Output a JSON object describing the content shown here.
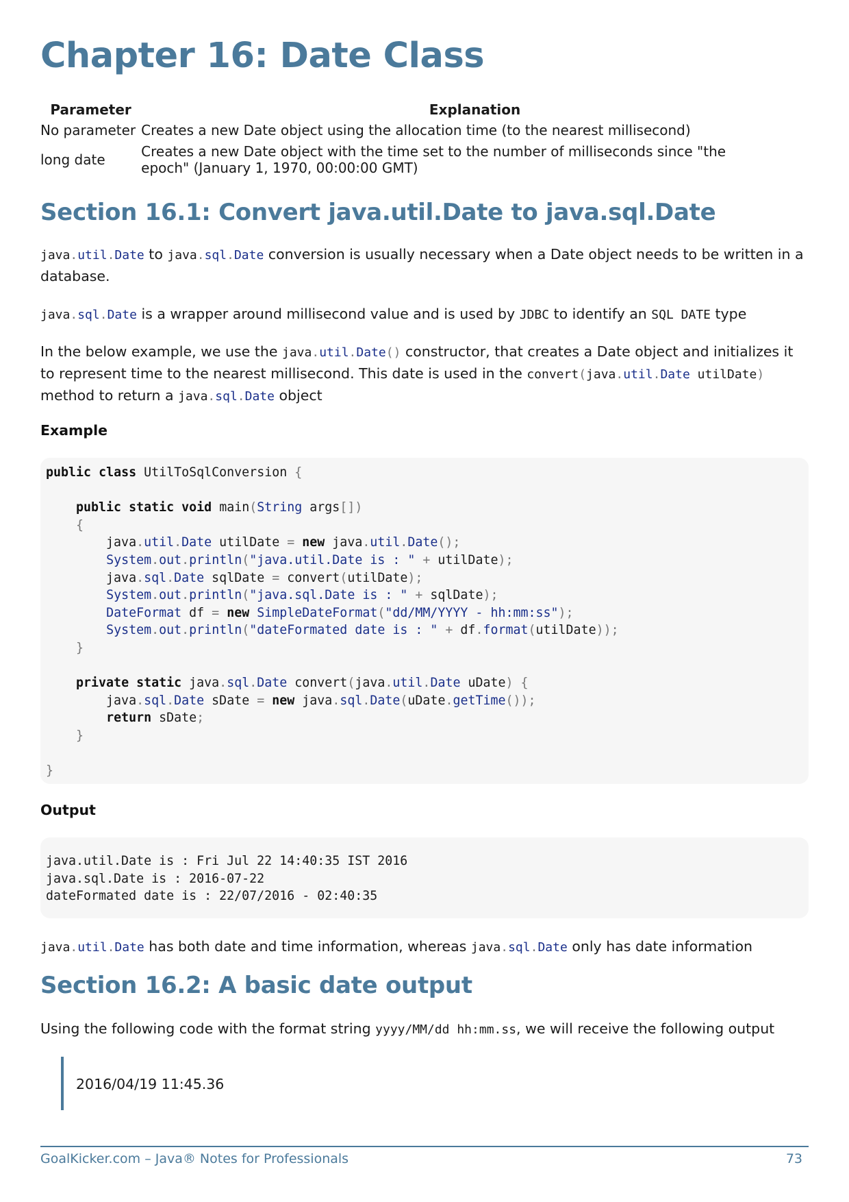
{
  "chapter_title": "Chapter 16: Date Class",
  "param_table": {
    "headers": [
      "Parameter",
      "Explanation"
    ],
    "rows": [
      [
        "No parameter",
        "Creates a new Date object using the allocation time (to the nearest millisecond)"
      ],
      [
        "long date",
        "Creates a new Date object with the time set to the number of milliseconds since \"the epoch\" (January 1, 1970, 00:00:00 GMT)"
      ]
    ]
  },
  "section1": {
    "title": "Section 16.1: Convert java.util.Date to java.sql.Date",
    "p1_a": "java.util.Date",
    "p1_b": " to ",
    "p1_c": "java.sql.Date",
    "p1_d": " conversion is usually necessary when a Date object needs to be written in a database.",
    "p2_a": "java.sql.Date",
    "p2_b": " is a wrapper around millisecond value and is used by ",
    "p2_c": "JDBC",
    "p2_d": " to identify an ",
    "p2_e": "SQL DATE",
    "p2_f": " type",
    "p3_a": "In the below example, we use the ",
    "p3_b": "java.util.Date()",
    "p3_c": " constructor, that creates a Date object and initializes it to represent time to the nearest millisecond. This date is used in the ",
    "p3_d": "convert(java.util.Date utilDate)",
    "p3_e": " method to return a ",
    "p3_f": "java.sql.Date",
    "p3_g": " object",
    "example_label": "Example",
    "output_label": "Output",
    "output_lines": [
      "java.util.Date is : Fri Jul 22 14:40:35 IST 2016",
      "java.sql.Date is : 2016-07-22",
      "dateFormated date is : 22/07/2016 - 02:40:35"
    ],
    "p4_a": "java.util.Date",
    "p4_b": " has both date and time information, whereas ",
    "p4_c": "java.sql.Date",
    "p4_d": " only has date information"
  },
  "section2": {
    "title": "Section 16.2: A basic date output",
    "p1_a": "Using the following code with the format string ",
    "p1_b": "yyyy/MM/dd hh:mm.ss",
    "p1_c": ", we will receive the following output",
    "quote": "2016/04/19 11:45.36"
  },
  "footer": {
    "left": "GoalKicker.com – Java® Notes for Professionals",
    "page": "73"
  }
}
